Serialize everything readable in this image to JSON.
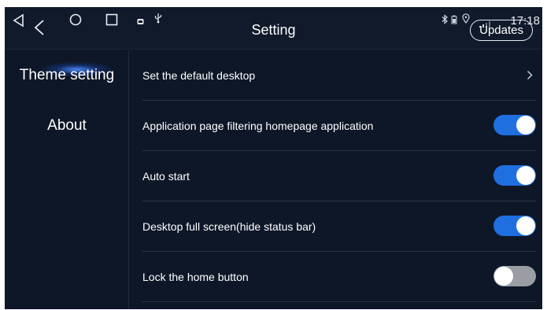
{
  "window": {
    "title": "Setting"
  },
  "nav": {
    "icons": [
      "back-triangle-icon",
      "back-chevron-icon",
      "home-circle-icon",
      "recents-square-icon"
    ]
  },
  "status": {
    "icons": [
      "notification-icon",
      "usb-icon",
      "bluetooth-icon",
      "location-icon",
      "signal-icon"
    ],
    "clock": "17:18",
    "updates_label": "Updates"
  },
  "sidebar": {
    "items": [
      {
        "label": "Theme setting",
        "active": true
      },
      {
        "label": "About",
        "active": false
      }
    ]
  },
  "settings": {
    "rows": [
      {
        "label": "Set the default desktop",
        "control": "chevron"
      },
      {
        "label": "Application page filtering homepage application",
        "control": "toggle",
        "on": true
      },
      {
        "label": "Auto start",
        "control": "toggle",
        "on": true
      },
      {
        "label": "Desktop full screen(hide status bar)",
        "control": "toggle",
        "on": true
      },
      {
        "label": "Lock the home button",
        "control": "toggle",
        "on": false
      }
    ]
  },
  "colors": {
    "background": "#0e1728",
    "toggle_on": "#1f6fe0",
    "toggle_off": "#9a9ea4",
    "active_glow": "#4c8cff"
  }
}
